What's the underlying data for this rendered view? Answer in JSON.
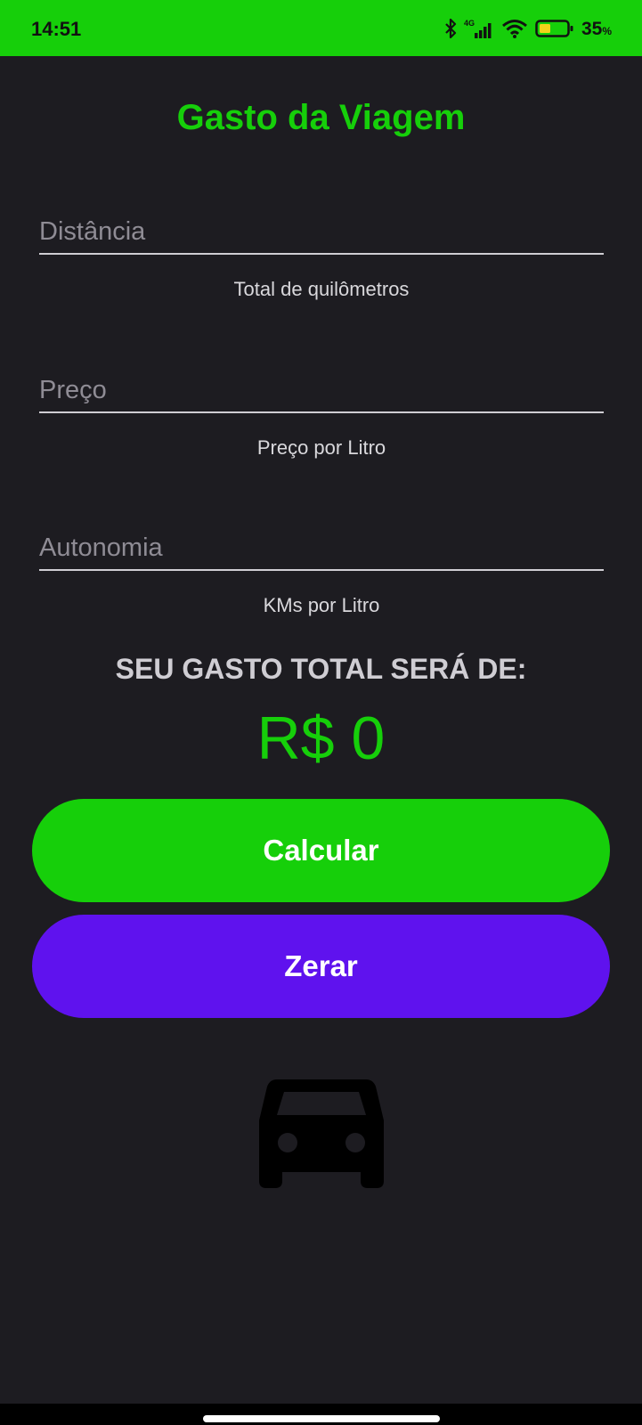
{
  "status_bar": {
    "time": "14:51",
    "network": "4G",
    "battery_percent": "35",
    "battery_unit": "%",
    "battery_level": 0.35,
    "color": "#16cf0a"
  },
  "app": {
    "title": "Gasto da Viagem",
    "accent_color": "#16cf0a",
    "background_color": "#1d1c21"
  },
  "fields": {
    "distancia": {
      "placeholder": "Distância",
      "value": "",
      "helper": "Total de quilômetros"
    },
    "preco": {
      "placeholder": "Preço",
      "value": "",
      "helper": "Preço por Litro"
    },
    "autonomia": {
      "placeholder": "Autonomia",
      "value": "",
      "helper": "KMs por Litro"
    }
  },
  "result": {
    "label": "SEU GASTO TOTAL SERÁ DE:",
    "value": "R$ 0"
  },
  "buttons": {
    "calcular": {
      "label": "Calcular",
      "color": "#16cf0a"
    },
    "zerar": {
      "label": "Zerar",
      "color": "#5f12ee"
    }
  },
  "icons": {
    "car": "car-icon"
  }
}
